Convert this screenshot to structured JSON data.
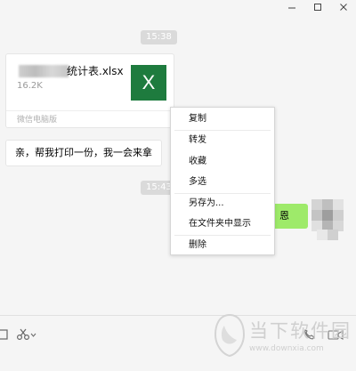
{
  "window_controls": {
    "minimize": "—",
    "maximize": "□",
    "close": "✕"
  },
  "messages": {
    "time_1": "15:38",
    "file": {
      "name_suffix": "统计表.xlsx",
      "size": "16.2K",
      "icon_letter": "X",
      "source": "微信电脑版"
    },
    "text_left": "亲，帮我打印一份，我一会来拿",
    "time_2": "15:43",
    "text_right": "恩"
  },
  "context_menu": {
    "items": [
      "复制",
      "转发",
      "收藏",
      "多选",
      "另存为...",
      "在文件夹中显示",
      "删除"
    ]
  },
  "watermark": {
    "title": "当下软件园",
    "url": "www.downxia.com"
  },
  "colors": {
    "bubble_self": "#9eea6a",
    "excel": "#1e7b3e",
    "time_chip": "#dadada"
  }
}
